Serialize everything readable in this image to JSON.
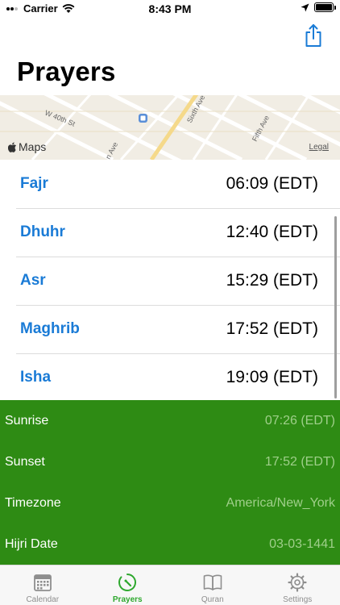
{
  "status": {
    "carrier": "Carrier",
    "time": "8:43 PM"
  },
  "header": {
    "title": "Prayers",
    "share_icon": "share-icon"
  },
  "map": {
    "streets": [
      "W 40th St",
      "Sixth Ave",
      "Fifth Ave",
      "n Ave"
    ],
    "logo": "Maps",
    "legal": "Legal"
  },
  "prayers": [
    {
      "name": "Fajr",
      "time": "06:09 (EDT)"
    },
    {
      "name": "Dhuhr",
      "time": "12:40 (EDT)"
    },
    {
      "name": "Asr",
      "time": "15:29 (EDT)"
    },
    {
      "name": "Maghrib",
      "time": "17:52 (EDT)"
    },
    {
      "name": "Isha",
      "time": "19:09 (EDT)"
    }
  ],
  "info": [
    {
      "label": "Sunrise",
      "value": "07:26 (EDT)"
    },
    {
      "label": "Sunset",
      "value": "17:52 (EDT)"
    },
    {
      "label": "Timezone",
      "value": "America/New_York"
    },
    {
      "label": "Hijri Date",
      "value": "03-03-1441"
    }
  ],
  "tabs": [
    {
      "label": "Calendar",
      "icon": "calendar-icon",
      "active": false
    },
    {
      "label": "Prayers",
      "icon": "compass-icon",
      "active": true
    },
    {
      "label": "Quran",
      "icon": "book-icon",
      "active": false
    },
    {
      "label": "Settings",
      "icon": "gear-icon",
      "active": false
    }
  ],
  "colors": {
    "accent_blue": "#1a7bd6",
    "panel_green": "#2e8b14",
    "tab_active": "#2ea82e"
  }
}
